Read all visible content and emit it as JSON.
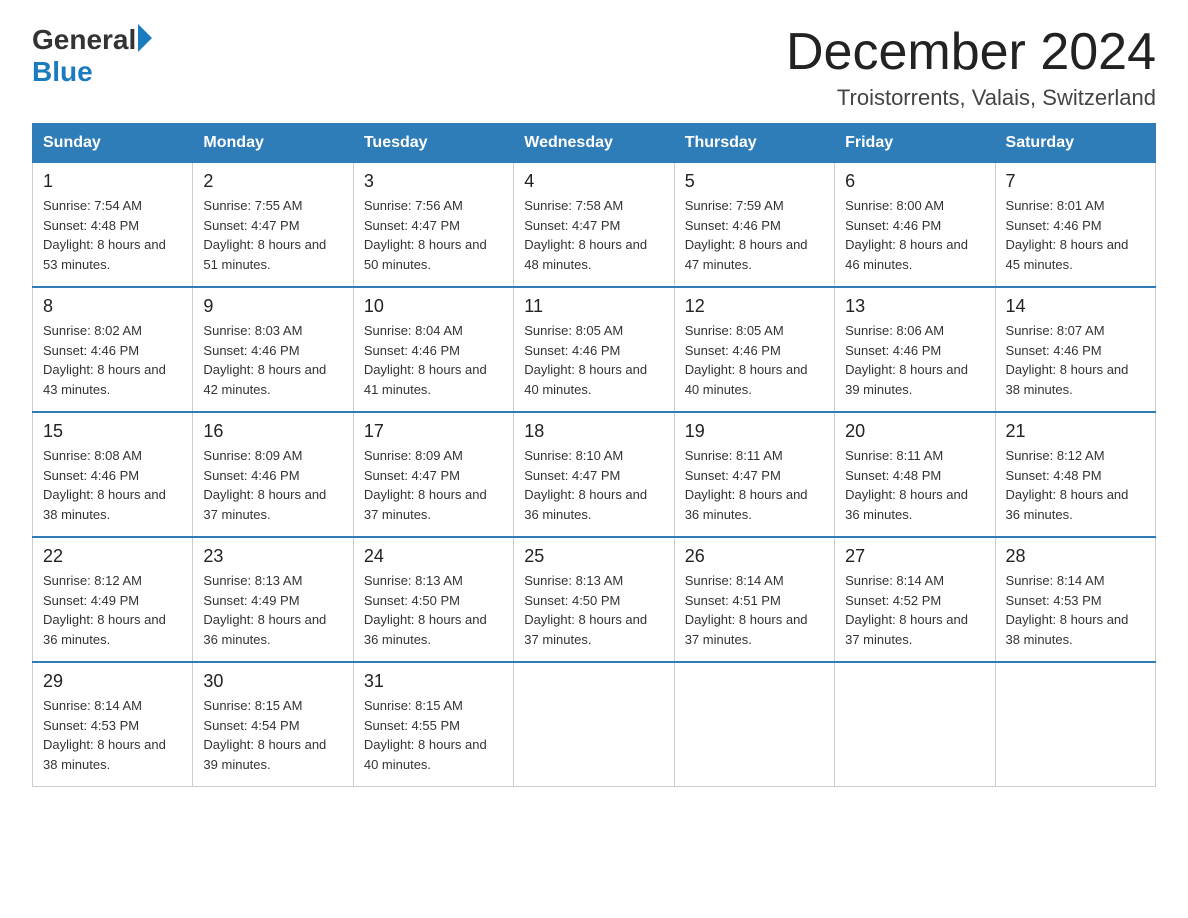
{
  "header": {
    "logo_general": "General",
    "logo_blue": "Blue",
    "month_title": "December 2024",
    "location": "Troistorrents, Valais, Switzerland"
  },
  "days_of_week": [
    "Sunday",
    "Monday",
    "Tuesday",
    "Wednesday",
    "Thursday",
    "Friday",
    "Saturday"
  ],
  "weeks": [
    [
      {
        "day": "1",
        "sunrise": "7:54 AM",
        "sunset": "4:48 PM",
        "daylight": "8 hours and 53 minutes."
      },
      {
        "day": "2",
        "sunrise": "7:55 AM",
        "sunset": "4:47 PM",
        "daylight": "8 hours and 51 minutes."
      },
      {
        "day": "3",
        "sunrise": "7:56 AM",
        "sunset": "4:47 PM",
        "daylight": "8 hours and 50 minutes."
      },
      {
        "day": "4",
        "sunrise": "7:58 AM",
        "sunset": "4:47 PM",
        "daylight": "8 hours and 48 minutes."
      },
      {
        "day": "5",
        "sunrise": "7:59 AM",
        "sunset": "4:46 PM",
        "daylight": "8 hours and 47 minutes."
      },
      {
        "day": "6",
        "sunrise": "8:00 AM",
        "sunset": "4:46 PM",
        "daylight": "8 hours and 46 minutes."
      },
      {
        "day": "7",
        "sunrise": "8:01 AM",
        "sunset": "4:46 PM",
        "daylight": "8 hours and 45 minutes."
      }
    ],
    [
      {
        "day": "8",
        "sunrise": "8:02 AM",
        "sunset": "4:46 PM",
        "daylight": "8 hours and 43 minutes."
      },
      {
        "day": "9",
        "sunrise": "8:03 AM",
        "sunset": "4:46 PM",
        "daylight": "8 hours and 42 minutes."
      },
      {
        "day": "10",
        "sunrise": "8:04 AM",
        "sunset": "4:46 PM",
        "daylight": "8 hours and 41 minutes."
      },
      {
        "day": "11",
        "sunrise": "8:05 AM",
        "sunset": "4:46 PM",
        "daylight": "8 hours and 40 minutes."
      },
      {
        "day": "12",
        "sunrise": "8:05 AM",
        "sunset": "4:46 PM",
        "daylight": "8 hours and 40 minutes."
      },
      {
        "day": "13",
        "sunrise": "8:06 AM",
        "sunset": "4:46 PM",
        "daylight": "8 hours and 39 minutes."
      },
      {
        "day": "14",
        "sunrise": "8:07 AM",
        "sunset": "4:46 PM",
        "daylight": "8 hours and 38 minutes."
      }
    ],
    [
      {
        "day": "15",
        "sunrise": "8:08 AM",
        "sunset": "4:46 PM",
        "daylight": "8 hours and 38 minutes."
      },
      {
        "day": "16",
        "sunrise": "8:09 AM",
        "sunset": "4:46 PM",
        "daylight": "8 hours and 37 minutes."
      },
      {
        "day": "17",
        "sunrise": "8:09 AM",
        "sunset": "4:47 PM",
        "daylight": "8 hours and 37 minutes."
      },
      {
        "day": "18",
        "sunrise": "8:10 AM",
        "sunset": "4:47 PM",
        "daylight": "8 hours and 36 minutes."
      },
      {
        "day": "19",
        "sunrise": "8:11 AM",
        "sunset": "4:47 PM",
        "daylight": "8 hours and 36 minutes."
      },
      {
        "day": "20",
        "sunrise": "8:11 AM",
        "sunset": "4:48 PM",
        "daylight": "8 hours and 36 minutes."
      },
      {
        "day": "21",
        "sunrise": "8:12 AM",
        "sunset": "4:48 PM",
        "daylight": "8 hours and 36 minutes."
      }
    ],
    [
      {
        "day": "22",
        "sunrise": "8:12 AM",
        "sunset": "4:49 PM",
        "daylight": "8 hours and 36 minutes."
      },
      {
        "day": "23",
        "sunrise": "8:13 AM",
        "sunset": "4:49 PM",
        "daylight": "8 hours and 36 minutes."
      },
      {
        "day": "24",
        "sunrise": "8:13 AM",
        "sunset": "4:50 PM",
        "daylight": "8 hours and 36 minutes."
      },
      {
        "day": "25",
        "sunrise": "8:13 AM",
        "sunset": "4:50 PM",
        "daylight": "8 hours and 37 minutes."
      },
      {
        "day": "26",
        "sunrise": "8:14 AM",
        "sunset": "4:51 PM",
        "daylight": "8 hours and 37 minutes."
      },
      {
        "day": "27",
        "sunrise": "8:14 AM",
        "sunset": "4:52 PM",
        "daylight": "8 hours and 37 minutes."
      },
      {
        "day": "28",
        "sunrise": "8:14 AM",
        "sunset": "4:53 PM",
        "daylight": "8 hours and 38 minutes."
      }
    ],
    [
      {
        "day": "29",
        "sunrise": "8:14 AM",
        "sunset": "4:53 PM",
        "daylight": "8 hours and 38 minutes."
      },
      {
        "day": "30",
        "sunrise": "8:15 AM",
        "sunset": "4:54 PM",
        "daylight": "8 hours and 39 minutes."
      },
      {
        "day": "31",
        "sunrise": "8:15 AM",
        "sunset": "4:55 PM",
        "daylight": "8 hours and 40 minutes."
      },
      null,
      null,
      null,
      null
    ]
  ]
}
